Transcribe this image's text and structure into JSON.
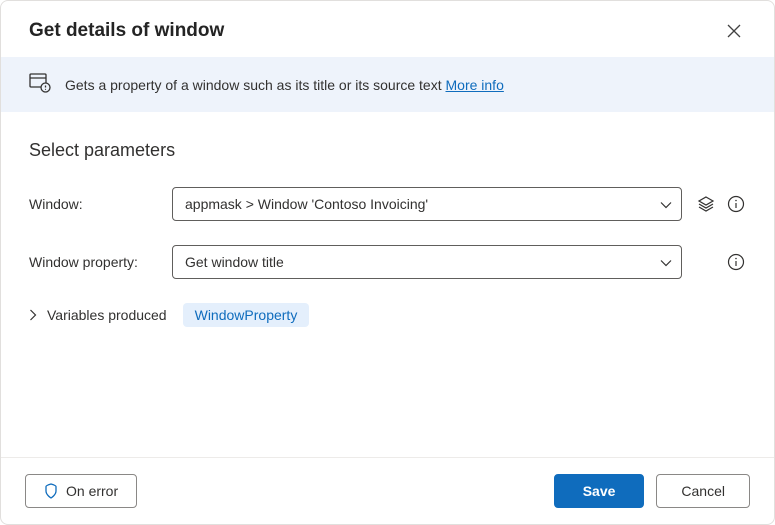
{
  "header": {
    "title": "Get details of window"
  },
  "banner": {
    "text": "Gets a property of a window such as its title or its source text ",
    "more_info": "More info"
  },
  "section": {
    "title": "Select parameters"
  },
  "fields": {
    "window": {
      "label": "Window:",
      "value": "appmask > Window 'Contoso Invoicing'"
    },
    "window_property": {
      "label": "Window property:",
      "value": "Get window title"
    }
  },
  "variables": {
    "label": "Variables produced",
    "chip": "WindowProperty"
  },
  "footer": {
    "on_error": "On error",
    "save": "Save",
    "cancel": "Cancel"
  }
}
